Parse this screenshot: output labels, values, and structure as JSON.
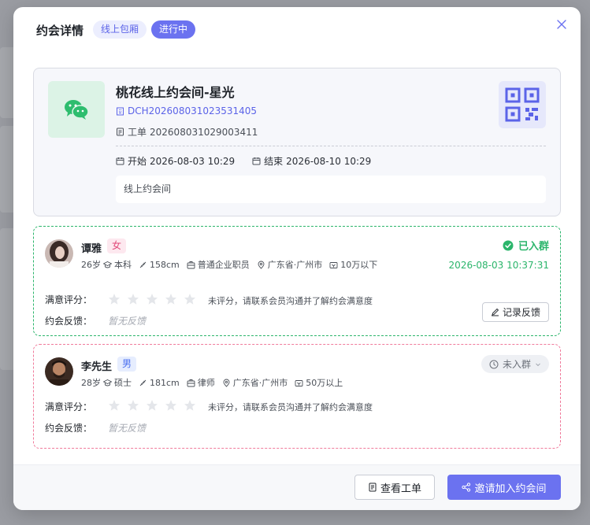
{
  "modal": {
    "title": "约会详情",
    "type_tag": "线上包厢",
    "status_tag": "进行中"
  },
  "room": {
    "name": "桃花线上约会间-星光",
    "code": "DCH202608031023531405",
    "ticket_label": "工单",
    "ticket_no": "202608031029003411",
    "start_label": "开始",
    "start_time": "2026-08-03 10:29",
    "end_label": "结束",
    "end_time": "2026-08-10 10:29",
    "description": "线上约会间"
  },
  "members": [
    {
      "name": "谭雅",
      "gender": "女",
      "age": "26岁",
      "education": "本科",
      "height": "158cm",
      "job": "普通企业职员",
      "location": "广东省·广州市",
      "income": "10万以下",
      "group_status": "已入群",
      "joined_time": "2026-08-03 10:37:31",
      "rating_label": "满意评分：",
      "rating_hint": "未评分，请联系会员沟通并了解约会满意度",
      "feedback_label": "约会反馈：",
      "feedback": "暂无反馈",
      "record_button": "记录反馈"
    },
    {
      "name": "李先生",
      "gender": "男",
      "age": "28岁",
      "education": "硕士",
      "height": "181cm",
      "job": "律师",
      "location": "广东省·广州市",
      "income": "50万以上",
      "group_status": "未入群",
      "rating_label": "满意评分：",
      "rating_hint": "未评分，请联系会员沟通并了解约会满意度",
      "feedback_label": "约会反馈：",
      "feedback": "暂无反馈"
    }
  ],
  "footer": {
    "view_ticket": "查看工单",
    "invite": "邀请加入约会间"
  },
  "colors": {
    "accent": "#6b72f0",
    "success": "#2bb56b",
    "female_border": "#f07a9b",
    "wechat": "#2dbd6e"
  }
}
